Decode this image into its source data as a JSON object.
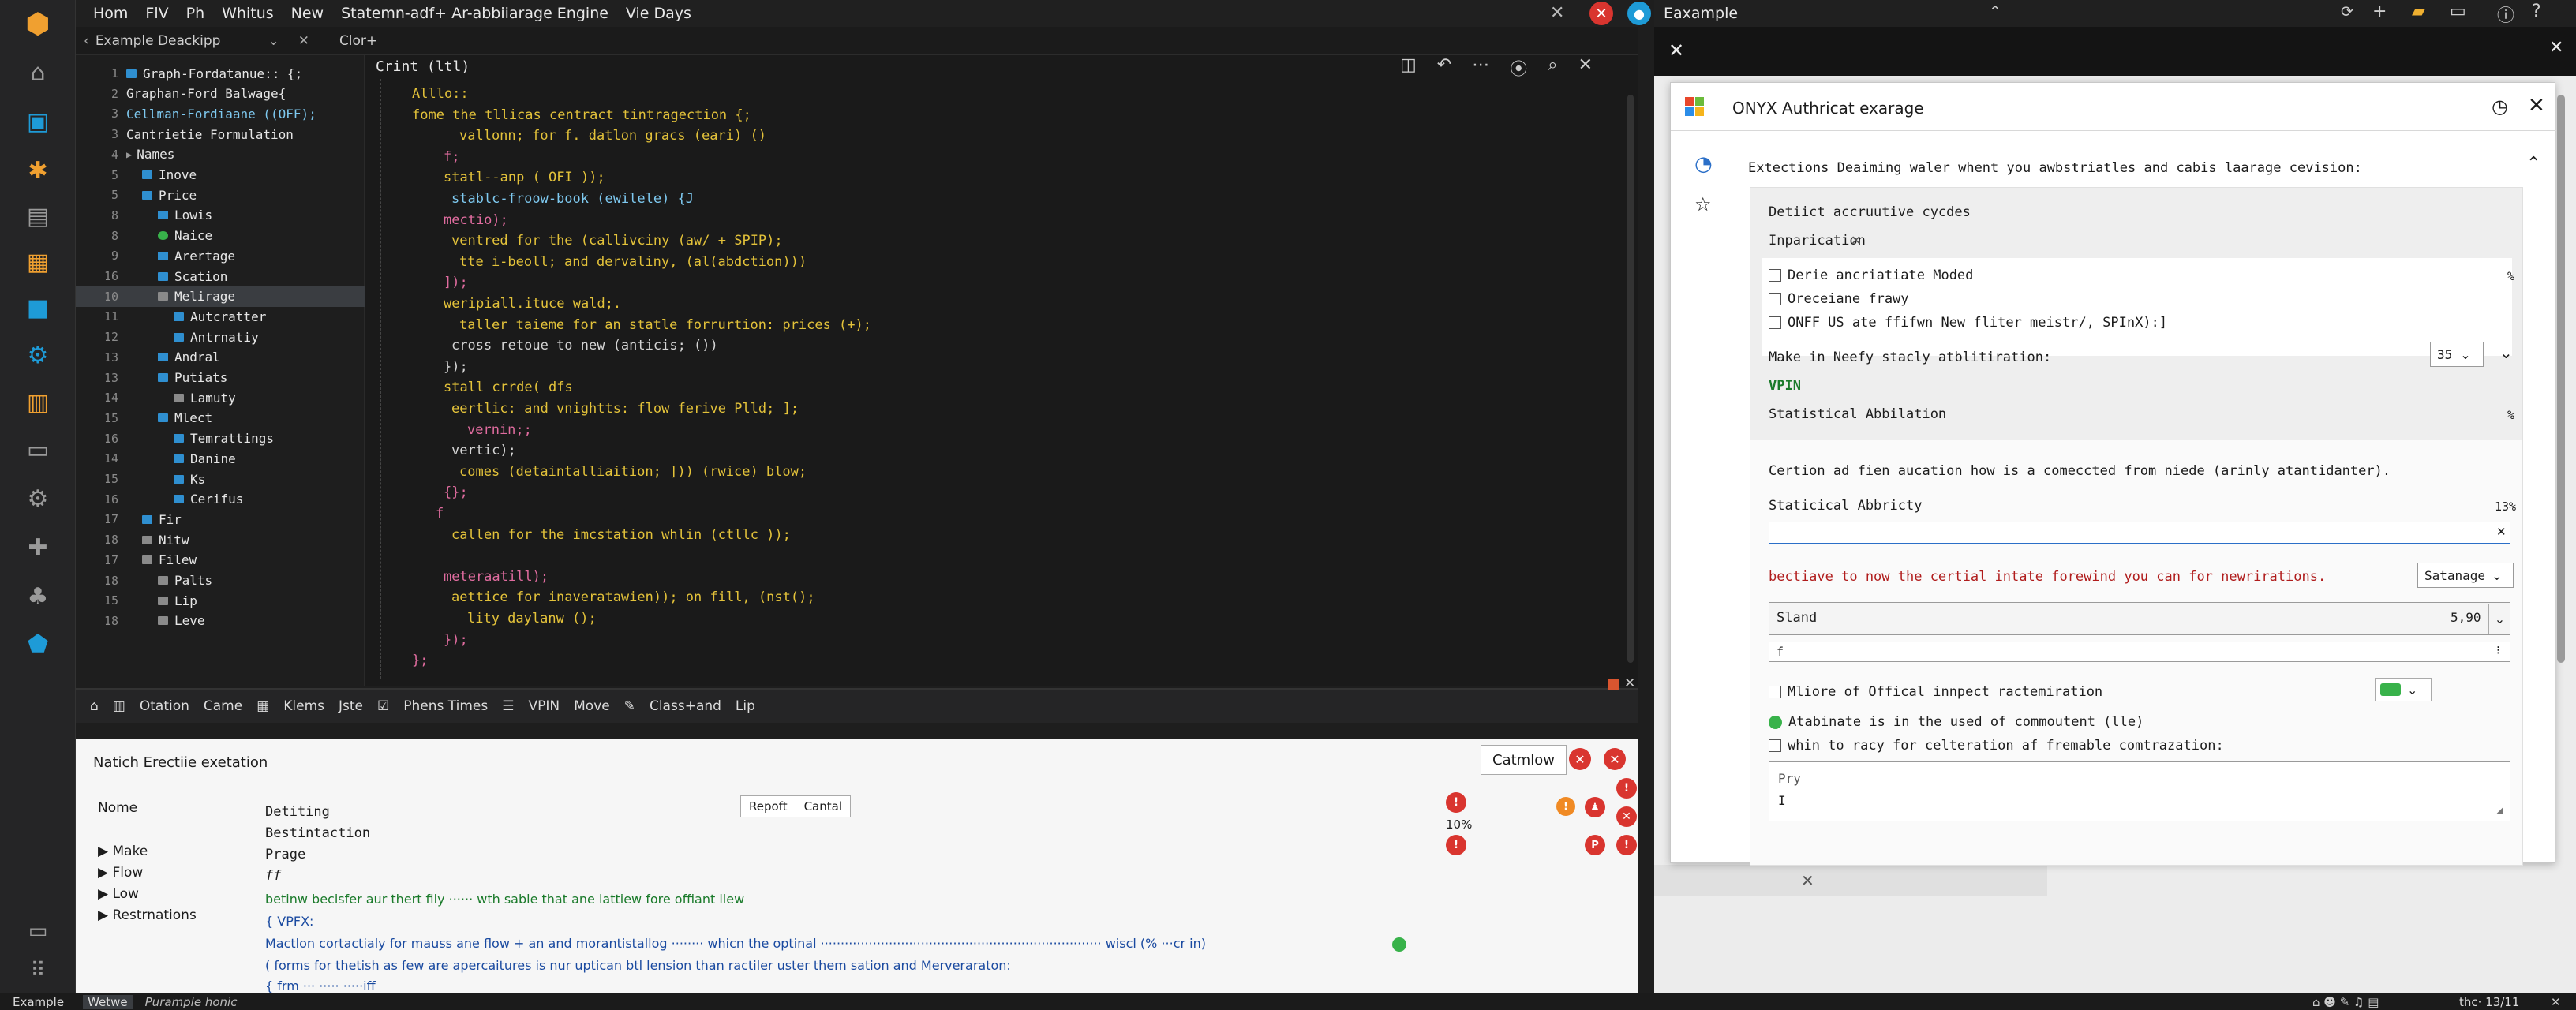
{
  "menubar": {
    "items": [
      "Hom",
      "FlV",
      "Ph",
      "Whitus",
      "New",
      "Statemn-adf+ Ar-abbiiarage Engine",
      "Vie Days"
    ]
  },
  "tabstrip": {
    "panel_title": "Example Deackipp",
    "editor_tab": "Clor+"
  },
  "explorer": {
    "rows": [
      {
        "n": "1",
        "label": "Graph-Fordatanue:: {;",
        "icon": "folder",
        "indent": 0
      },
      {
        "n": "2",
        "label": "Graphan-Ford Balwage{",
        "icon": "none",
        "indent": 0
      },
      {
        "n": "3",
        "label": "Cellman-Fordiaane ((OFF);",
        "icon": "none",
        "indent": 0
      },
      {
        "n": "3",
        "label": "Cantrietie Formulation",
        "icon": "none",
        "indent": 0
      },
      {
        "n": "4",
        "label": "Names",
        "icon": "arrow",
        "indent": 0
      },
      {
        "n": "5",
        "label": "Inove",
        "icon": "folder",
        "indent": 1
      },
      {
        "n": "5",
        "label": "Price",
        "icon": "folder",
        "indent": 1
      },
      {
        "n": "8",
        "label": "Lowis",
        "icon": "folder",
        "indent": 2
      },
      {
        "n": "8",
        "label": "Naice",
        "icon": "green",
        "indent": 2
      },
      {
        "n": "9",
        "label": "Arertage",
        "icon": "folder",
        "indent": 2
      },
      {
        "n": "16",
        "label": "Scation",
        "icon": "folder",
        "indent": 2
      },
      {
        "n": "10",
        "label": "Melirage",
        "icon": "gray",
        "indent": 2
      },
      {
        "n": "11",
        "label": "Autcratter",
        "icon": "folder",
        "indent": 3
      },
      {
        "n": "12",
        "label": "Antrnatiy",
        "icon": "folder",
        "indent": 3
      },
      {
        "n": "13",
        "label": "Andral",
        "icon": "folder",
        "indent": 2
      },
      {
        "n": "13",
        "label": "Putiats",
        "icon": "folder",
        "indent": 2
      },
      {
        "n": "14",
        "label": "Lamuty",
        "icon": "gray",
        "indent": 3
      },
      {
        "n": "15",
        "label": "Mlect",
        "icon": "folder",
        "indent": 2
      },
      {
        "n": "16",
        "label": "Temrattings",
        "icon": "folder",
        "indent": 3
      },
      {
        "n": "14",
        "label": "Danine",
        "icon": "folder",
        "indent": 3
      },
      {
        "n": "15",
        "label": "Ks",
        "icon": "folder",
        "indent": 3
      },
      {
        "n": "16",
        "label": "Cerifus",
        "icon": "folder",
        "indent": 3
      },
      {
        "n": "17",
        "label": "Fir",
        "icon": "folder",
        "indent": 1
      },
      {
        "n": "18",
        "label": "Nitw",
        "icon": "gray",
        "indent": 1
      },
      {
        "n": "17",
        "label": "Filew",
        "icon": "gray",
        "indent": 1
      },
      {
        "n": "18",
        "label": "Palts",
        "icon": "gray",
        "indent": 2
      },
      {
        "n": "15",
        "label": "Lip",
        "icon": "gray",
        "indent": 2
      },
      {
        "n": "18",
        "label": "Leve",
        "icon": "gray",
        "indent": 2
      }
    ]
  },
  "editor": {
    "header": "Crint (ltl)",
    "lines": [
      {
        "t": "Alllo::",
        "c": "#e3c23a",
        "x": 0
      },
      {
        "t": "fome the tllicas centract tintragection {;",
        "c": "#e3c23a",
        "x": 0
      },
      {
        "t": "vallonn; for f. datlon gracs (eari) ()",
        "c": "#e3c23a",
        "x": 60
      },
      {
        "t": "f;",
        "c": "#e06c9f",
        "x": 40
      },
      {
        "t": "statl--anp ( OFI ));",
        "c": "#e3c23a",
        "x": 40
      },
      {
        "t": "stablc-froow-book (ewilele) {J",
        "c": "#7ec9f0",
        "x": 50
      },
      {
        "t": "mectio);",
        "c": "#e06c9f",
        "x": 40
      },
      {
        "t": "ventred for the (callivciny (aw/ + SPIP);",
        "c": "#e3c23a",
        "x": 50
      },
      {
        "t": "tte i-beoll; and dervaliny, (al(abdction)))",
        "c": "#e3c23a",
        "x": 60
      },
      {
        "t": "]);",
        "c": "#e06c9f",
        "x": 40
      },
      {
        "t": "weripiall.ituce wald;.",
        "c": "#e3c23a",
        "x": 40
      },
      {
        "t": "taller taieme for an statle forrurtion: prices (+);",
        "c": "#e3c23a",
        "x": 60
      },
      {
        "t": "cross retoue to new (anticis; ())",
        "c": "#d4d4d4",
        "x": 50
      },
      {
        "t": "});",
        "c": "#d4d4d4",
        "x": 40
      },
      {
        "t": "stall crrde( dfs",
        "c": "#e3c23a",
        "x": 40
      },
      {
        "t": "eertlic: and vnightts: flow ferive Plld; ];",
        "c": "#e3c23a",
        "x": 50
      },
      {
        "t": "vernin;;",
        "c": "#e06c9f",
        "x": 70
      },
      {
        "t": "vertic);",
        "c": "#d4d4d4",
        "x": 50
      },
      {
        "t": "comes (detaintalliaition; ])) (rwice) blow;",
        "c": "#e3c23a",
        "x": 60
      },
      {
        "t": "{};",
        "c": "#e06c9f",
        "x": 40
      },
      {
        "t": "f",
        "c": "#e06c9f",
        "x": 30
      },
      {
        "t": "callen for the imcstation whlin (ctllc ));",
        "c": "#e3c23a",
        "x": 50
      },
      {
        "t": "",
        "c": "#d4d4d4",
        "x": 0
      },
      {
        "t": "meteraatill);",
        "c": "#e06c9f",
        "x": 40
      },
      {
        "t": "aettice for inaveratawien)); on fill, (nst();",
        "c": "#e3c23a",
        "x": 50
      },
      {
        "t": "lity daylanw ();",
        "c": "#e3c23a",
        "x": 70
      },
      {
        "t": "});",
        "c": "#e06c9f",
        "x": 40
      },
      {
        "t": "};",
        "c": "#e06c9f",
        "x": 0
      }
    ]
  },
  "panel_toolbar": {
    "items": [
      "Otation",
      "Came",
      "Klems",
      "Jste",
      "Phens Times",
      "VPIN",
      "Move",
      "Class+and",
      "Lip"
    ]
  },
  "panel": {
    "title": "Natich Erectiie exetation",
    "catmlow_button": "Catmlow",
    "nome_label": "Nome",
    "items": [
      "Make",
      "Flow",
      "Low",
      "Restrnations"
    ],
    "detail": [
      "Detiting",
      "Bestintaction",
      "Prage",
      "ff"
    ],
    "report_button": "Repoft",
    "cancel_button": "Cantal",
    "percent": "10%",
    "line1": "betinw becisfer aur thert fily ······ wth sable that ane lattiew fore offiant llew",
    "line2": "{ VPFX:",
    "line3": "Mactlon cortactialy for mauss ane flow + an and morantistallog ········ whicn the optinal ······································································ wiscl (% ···cr in)",
    "line4": "( forms for thetish as few are apercaitures is nur uptican btl lension than ractiler uster them sation and Merveraraton:",
    "line5": "{ frm  ··· ·····  ·····iff"
  },
  "status": {
    "left1": "Example",
    "left2": "Wetwe",
    "left3": "Purample honic",
    "right1": "thc· 13/11"
  },
  "rwin": {
    "title": "Eaxample",
    "dialog_title": "ONYX  Authricat exarage",
    "intro": "Extections Deaiming waler  whent you awbstriatles  and  cabis  laarage cevision:",
    "sec1_head": "Detiict accruutive cycdes",
    "sec1_sub": "Inparication",
    "chk1": "Derie ancriatiate Moded",
    "chk2": "Oreceiane frawy",
    "chk3": "ONFF US ate ffifwn New fliter meistr/, SPInX):]",
    "make_label": "Make in Neefy stacly atblitiration:",
    "make_value": "35",
    "vpin": "VPIN",
    "stat_abb": "Statistical Abbilation",
    "cert_text": "Certion ad fien aucation how is a comeccted from niede (arinly atantidanter).",
    "stat_abb2": "Staticical Abbricty",
    "stat_pct": "13%",
    "bect_text": "bectiave to now the certial intate forewind you can for newrirations.",
    "sat_select": "Satanage",
    "sland_label": "Sland",
    "sland_value": "5,90",
    "field_f": "f",
    "more_label": "Mliore of Offical innpect ractemiration",
    "atab_label": "Atabinate is in the used of commoutent (lle)",
    "whin_label": "whin to racy for celteration af fremable comtrazation:",
    "textarea_placeholder": "Pry",
    "pct_a": "%",
    "pct_b": "%"
  }
}
